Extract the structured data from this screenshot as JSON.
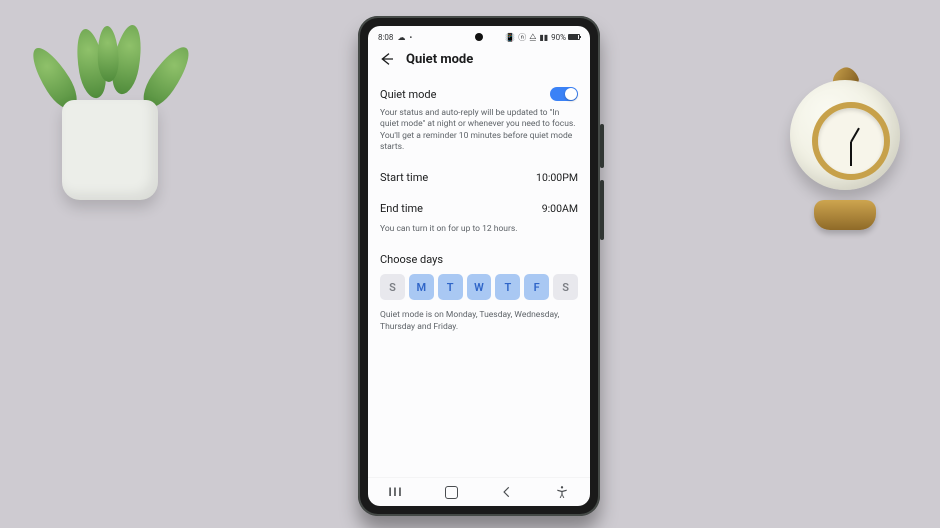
{
  "status": {
    "time": "8:08",
    "battery_pct": "90%"
  },
  "appbar": {
    "title": "Quiet mode"
  },
  "quiet_mode": {
    "label": "Quiet mode",
    "enabled": true,
    "description": "Your status and auto-reply will be updated to \"In quiet mode\" at night or whenever you need to focus. You'll get a reminder 10 minutes before quiet mode starts."
  },
  "start_time": {
    "label": "Start time",
    "value": "10:00PM"
  },
  "end_time": {
    "label": "End time",
    "value": "9:00AM"
  },
  "limit_help": "You can turn it on for up to 12 hours.",
  "choose_days": {
    "label": "Choose days",
    "days": [
      {
        "letter": "S",
        "selected": false
      },
      {
        "letter": "M",
        "selected": true
      },
      {
        "letter": "T",
        "selected": true
      },
      {
        "letter": "W",
        "selected": true
      },
      {
        "letter": "T",
        "selected": true
      },
      {
        "letter": "F",
        "selected": true
      },
      {
        "letter": "S",
        "selected": false
      }
    ],
    "summary": "Quiet mode is on Monday, Tuesday, Wednesday, Thursday and Friday."
  },
  "colors": {
    "accent": "#3b82f6",
    "day_selected_bg": "#a9c8f3",
    "day_selected_fg": "#2f65c8",
    "day_unselected_bg": "#e8e8ed",
    "day_unselected_fg": "#7b7e84",
    "desk": "#cecbd1"
  }
}
